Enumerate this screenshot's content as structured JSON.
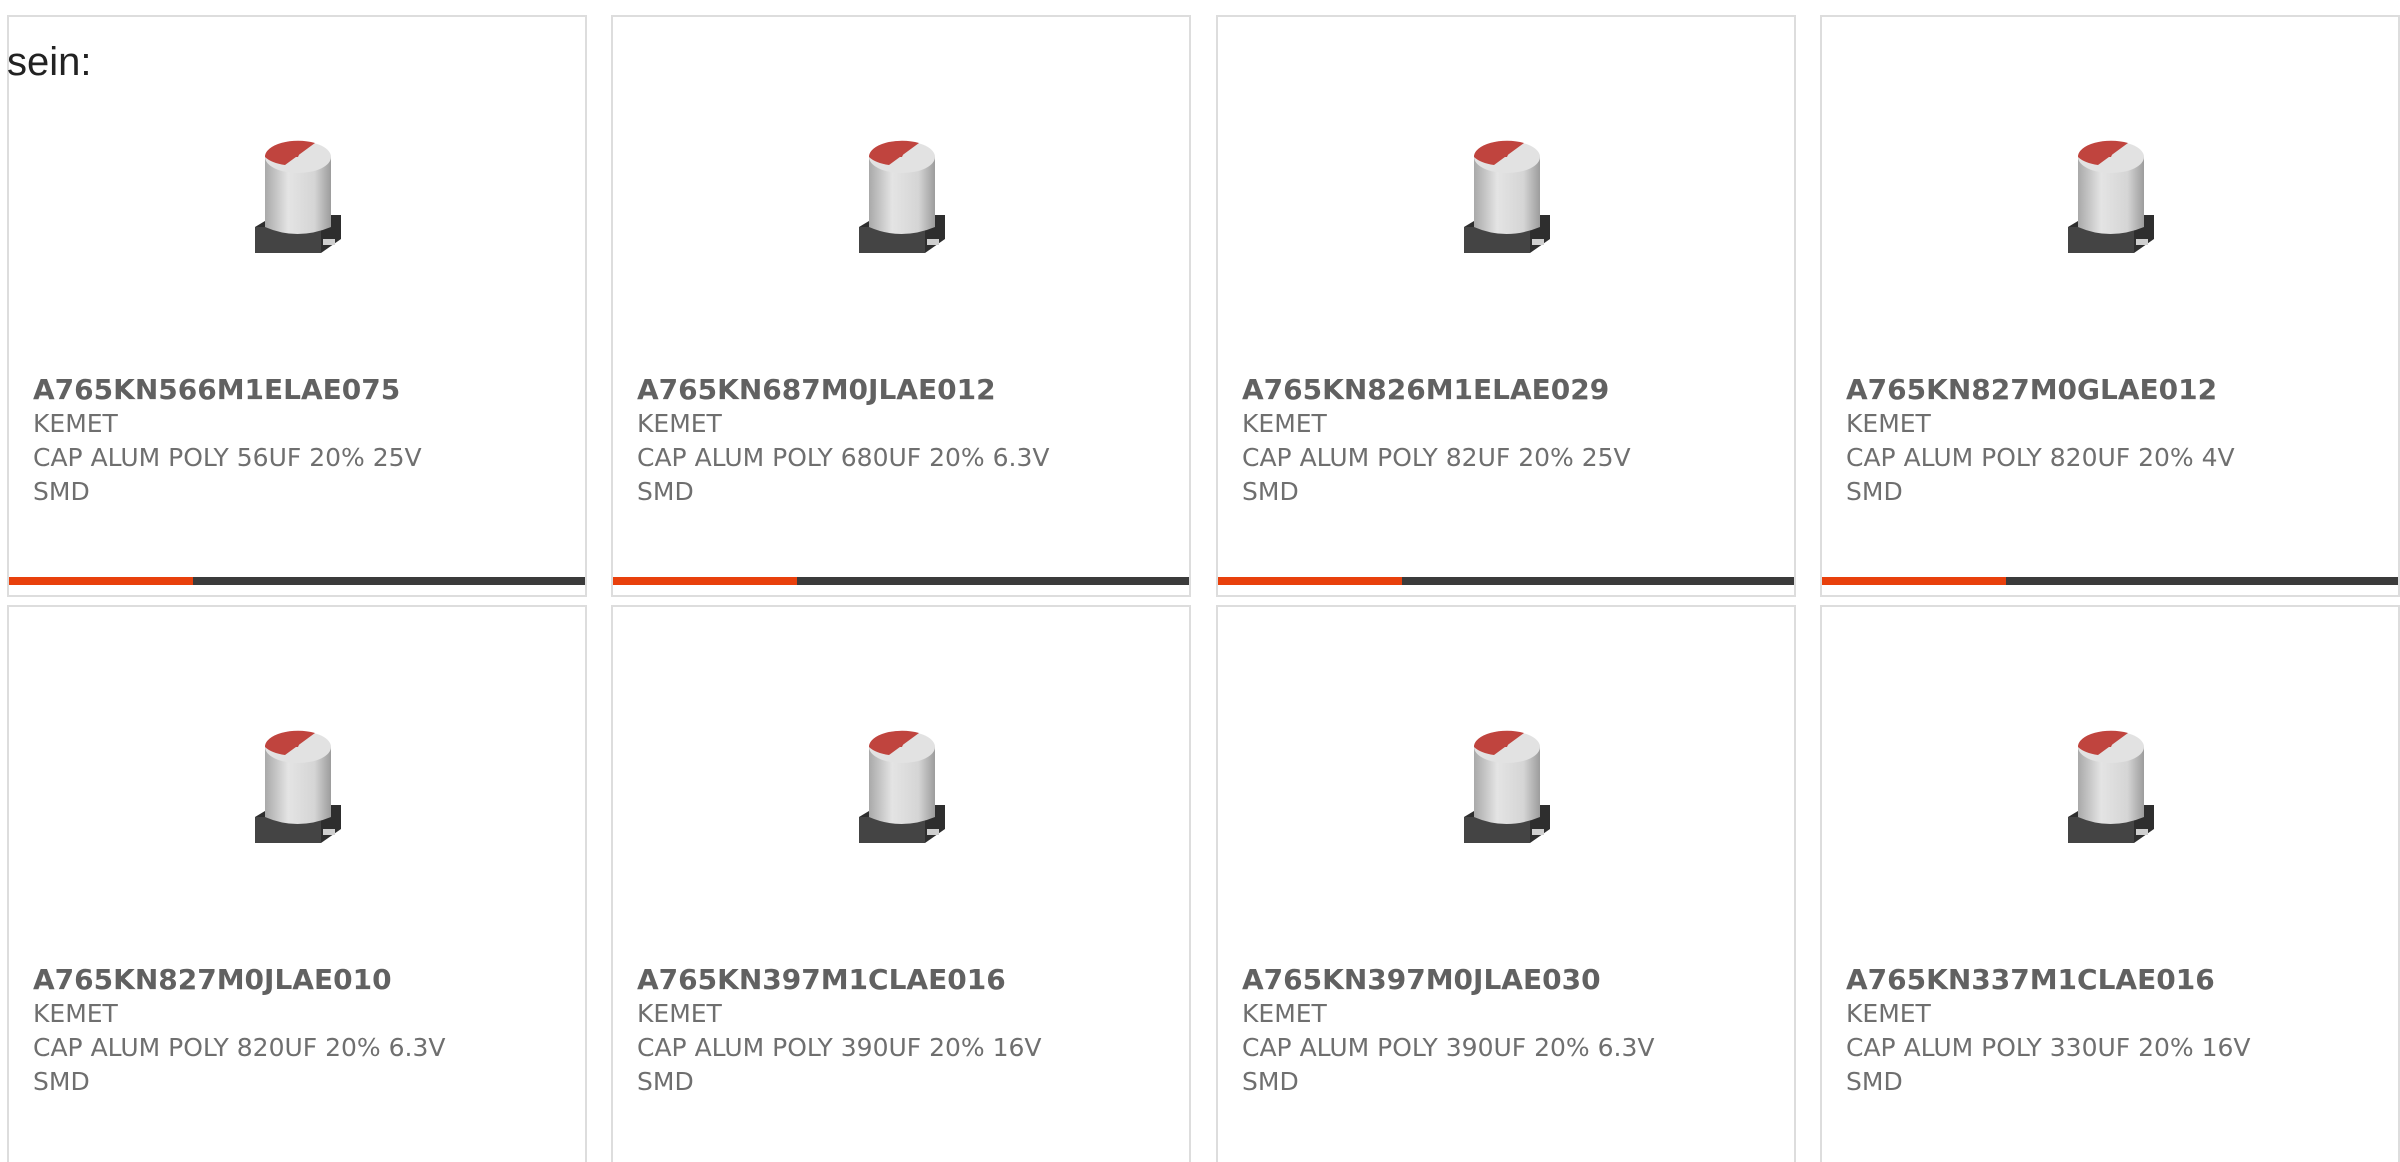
{
  "intro_text": "sein:",
  "colors": {
    "accent": "#e8400c",
    "track": "#3b3b3b",
    "border": "#dddddd",
    "cap_top": "#c0443e",
    "cap_body": "#d5d5d5",
    "cap_base": "#2e2e2e"
  },
  "products": [
    {
      "part_number": "A765KN566M1ELAE075",
      "manufacturer": "KEMET",
      "description": "CAP ALUM POLY 56UF 20% 25V",
      "mount": "SMD",
      "image_icon": "capacitor-image",
      "progress": 0.32
    },
    {
      "part_number": "A765KN687M0JLAE012",
      "manufacturer": "KEMET",
      "description": "CAP ALUM POLY 680UF 20% 6.3V",
      "mount": "SMD",
      "image_icon": "capacitor-image",
      "progress": 0.32
    },
    {
      "part_number": "A765KN826M1ELAE029",
      "manufacturer": "KEMET",
      "description": "CAP ALUM POLY 82UF 20% 25V",
      "mount": "SMD",
      "image_icon": "capacitor-image",
      "progress": 0.32
    },
    {
      "part_number": "A765KN827M0GLAE012",
      "manufacturer": "KEMET",
      "description": "CAP ALUM POLY 820UF 20% 4V",
      "mount": "SMD",
      "image_icon": "capacitor-image",
      "progress": 0.32
    },
    {
      "part_number": "A765KN827M0JLAE010",
      "manufacturer": "KEMET",
      "description": "CAP ALUM POLY 820UF 20% 6.3V",
      "mount": "SMD",
      "image_icon": "capacitor-image"
    },
    {
      "part_number": "A765KN397M1CLAE016",
      "manufacturer": "KEMET",
      "description": "CAP ALUM POLY 390UF 20% 16V",
      "mount": "SMD",
      "image_icon": "capacitor-image"
    },
    {
      "part_number": "A765KN397M0JLAE030",
      "manufacturer": "KEMET",
      "description": "CAP ALUM POLY 390UF 20% 6.3V",
      "mount": "SMD",
      "image_icon": "capacitor-image"
    },
    {
      "part_number": "A765KN337M1CLAE016",
      "manufacturer": "KEMET",
      "description": "CAP ALUM POLY 330UF 20% 16V",
      "mount": "SMD",
      "image_icon": "capacitor-image"
    }
  ]
}
